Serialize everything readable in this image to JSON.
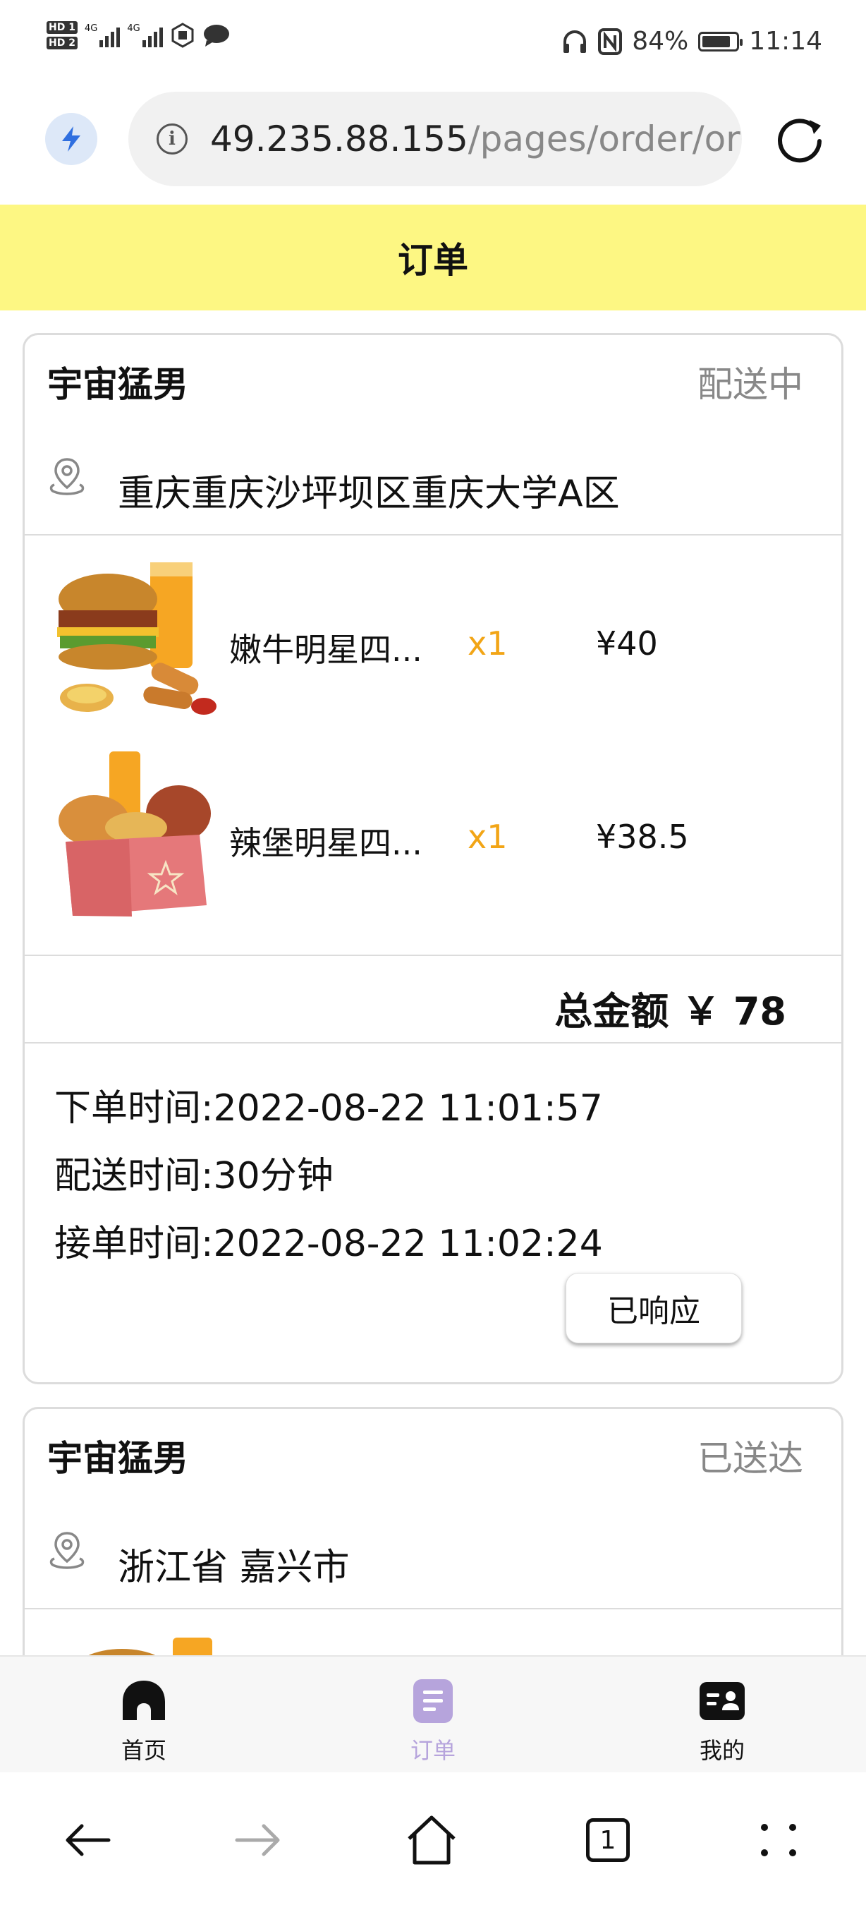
{
  "status_bar": {
    "hd_labels": [
      "HD 1",
      "HD 2"
    ],
    "network_labels": [
      "4G",
      "4G"
    ],
    "battery_percent": "84%",
    "battery_level": 0.84,
    "time": "11:14"
  },
  "browser": {
    "url_host": "49.235.88.155",
    "url_path": "/pages/order/or",
    "info_icon_glyph": "i",
    "bolt_icon": "lightning-bolt-icon",
    "reload_icon": "reload-icon"
  },
  "page": {
    "title": "订单"
  },
  "orders": [
    {
      "user": "宇宙猛男",
      "status": "配送中",
      "address": "重庆重庆沙坪坝区重庆大学A区",
      "items": [
        {
          "name": "嫩牛明星四...",
          "qty": "x1",
          "price": "¥40"
        },
        {
          "name": "辣堡明星四...",
          "qty": "x1",
          "price": "¥38.5"
        }
      ],
      "total": "总金额 ￥ 78",
      "order_time": "下单时间:2022-08-22 11:01:57",
      "delivery_time": "配送时间:30分钟",
      "accept_time": "接单时间:2022-08-22 11:02:24",
      "action_label": "已响应"
    },
    {
      "user": "宇宙猛男",
      "status": "已送达",
      "address": "浙江省 嘉兴市"
    }
  ],
  "tabs": [
    {
      "label": "首页",
      "icon": "home-icon",
      "active": false
    },
    {
      "label": "订单",
      "icon": "order-list-icon",
      "active": true
    },
    {
      "label": "我的",
      "icon": "profile-card-icon",
      "active": false
    }
  ],
  "colors": {
    "header_bg": "#fdf783",
    "qty_color": "#f2a516",
    "active_tab": "#b6a4dc",
    "status_grey": "#888888"
  },
  "nav": {
    "tab_count": "1"
  }
}
